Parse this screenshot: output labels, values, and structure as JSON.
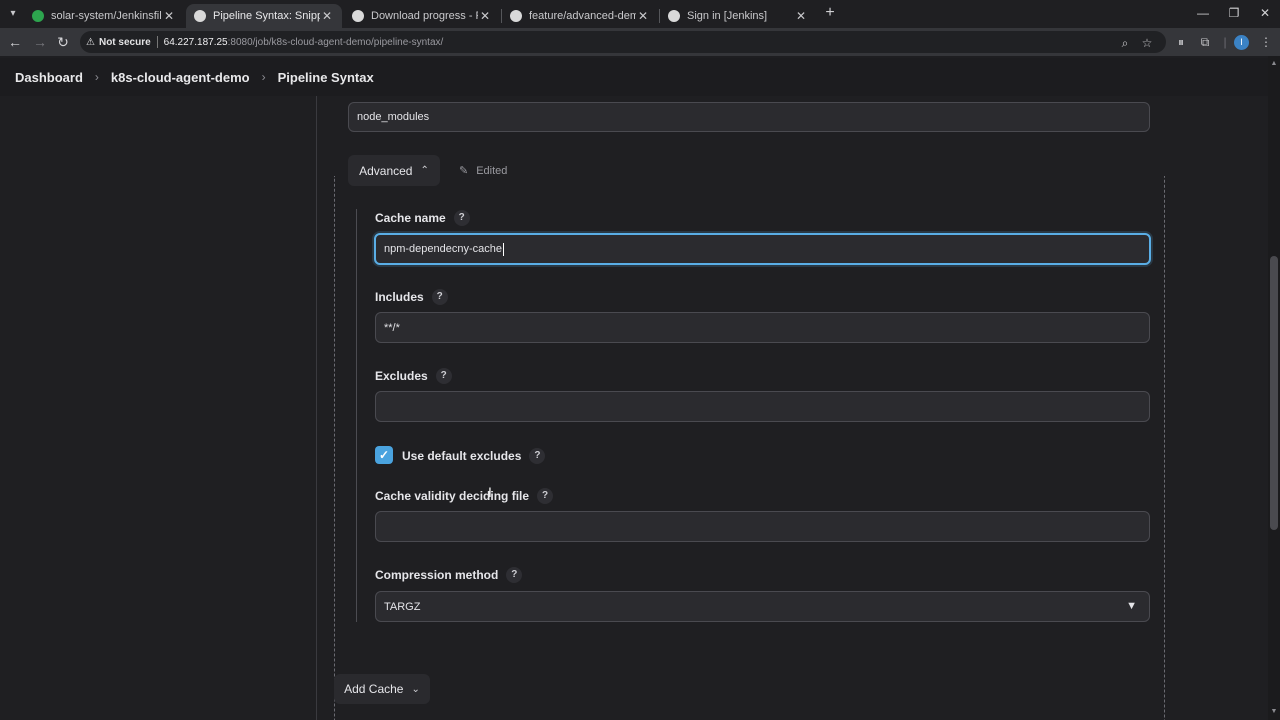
{
  "browser": {
    "tabs": [
      {
        "title": "solar-system/Jenkinsfile at feat",
        "favicon_color": "#2da44e",
        "active": false
      },
      {
        "title": "Pipeline Syntax: Snippet Generat",
        "favicon_color": "#d9d9d9",
        "active": true
      },
      {
        "title": "Download progress - Plugins [J",
        "favicon_color": "#d9d9d9",
        "active": false
      },
      {
        "title": "feature/advanced-demo [Gitea",
        "favicon_color": "#d9d9d9",
        "active": false
      },
      {
        "title": "Sign in [Jenkins]",
        "favicon_color": "#d9d9d9",
        "active": false
      }
    ],
    "not_secure_label": "Not secure",
    "url_host": "64.227.187.25",
    "url_path": ":8080/job/k8s-cloud-agent-demo/pipeline-syntax/",
    "profile_initial": "I"
  },
  "breadcrumb": {
    "items": [
      "Dashboard",
      "k8s-cloud-agent-demo",
      "Pipeline Syntax"
    ]
  },
  "form": {
    "path_value": "node_modules",
    "advanced_label": "Advanced",
    "edited_label": "Edited",
    "cache_name_label": "Cache name",
    "cache_name_value": "npm-dependecny-cache",
    "includes_label": "Includes",
    "includes_value": "**/*",
    "excludes_label": "Excludes",
    "excludes_value": "",
    "use_default_excludes_label": "Use default excludes",
    "use_default_excludes_checked": true,
    "validity_label": "Cache validity deciding file",
    "validity_value": "",
    "compression_label": "Compression method",
    "compression_value": "TARGZ",
    "help_glyph": "?",
    "add_cache_label": "Add Cache"
  },
  "colors": {
    "accent": "#4aa3df",
    "focus_ring": "#5aaee6",
    "background": "#1f1f22"
  }
}
